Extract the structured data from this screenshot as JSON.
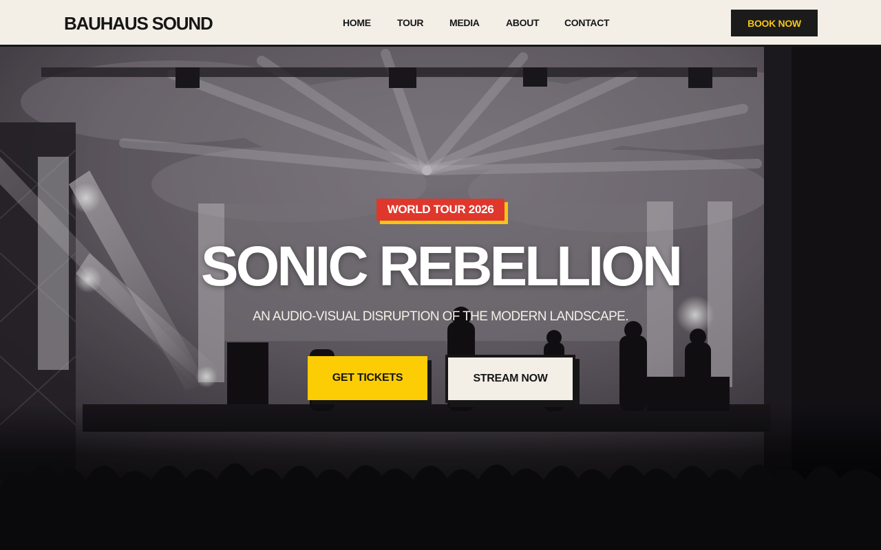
{
  "header": {
    "logo": "BAUHAUS SOUND",
    "nav": [
      "HOME",
      "TOUR",
      "MEDIA",
      "ABOUT",
      "CONTACT"
    ],
    "book_label": "BOOK NOW"
  },
  "hero": {
    "badge": "WORLD TOUR 2026",
    "title": "SONIC REBELLION",
    "subtitle": "AN AUDIO-VISUAL DISRUPTION OF THE MODERN LANDSCAPE.",
    "primary_cta": "GET TICKETS",
    "secondary_cta": "STREAM NOW"
  },
  "colors": {
    "header_bg": "#f3efe7",
    "ink": "#161616",
    "accent_yellow": "#fccd05",
    "accent_red": "#e0372c",
    "hero_tint": "#6e6670"
  }
}
